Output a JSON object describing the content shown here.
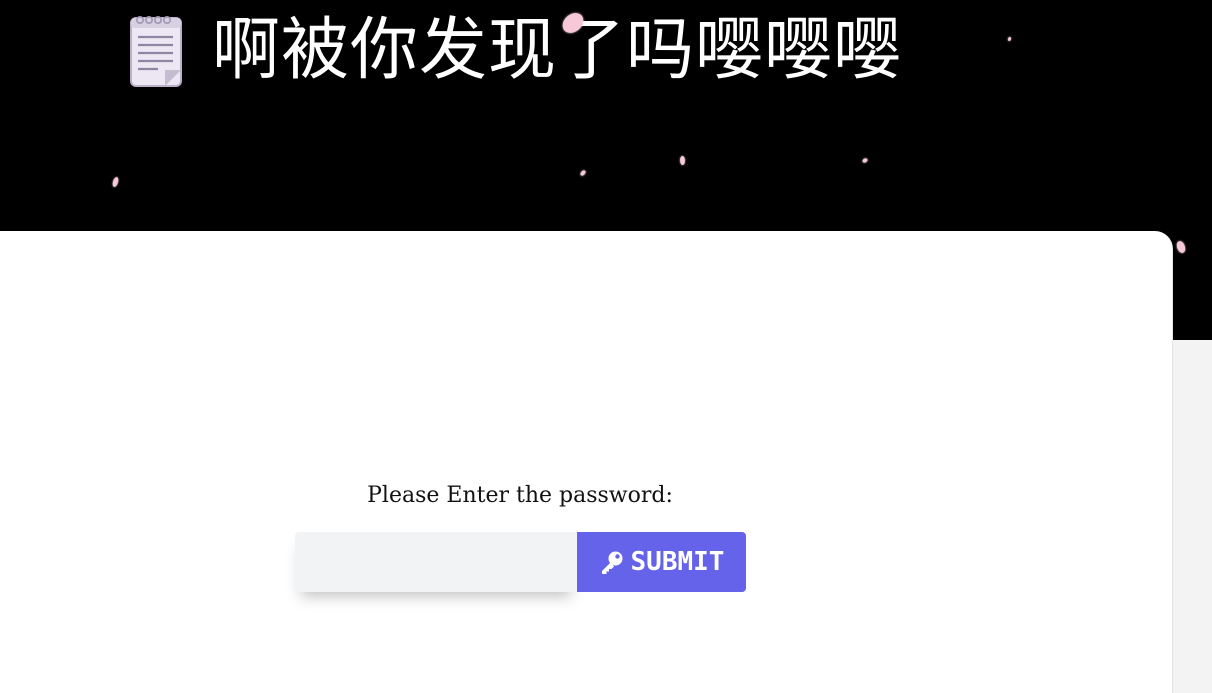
{
  "header": {
    "title": "啊被你发现了吗嘤嘤嘤",
    "title_icon": "notepad-icon",
    "decoration": "falling-cherry-blossom-petals",
    "background_color": "#000000",
    "petal_color": "#f7c9d8"
  },
  "login": {
    "prompt": "Please Enter the password:",
    "password_value": "",
    "password_placeholder": "",
    "submit_label": "SUBMIT",
    "submit_icon": "key-icon",
    "submit_color": "#6563e9"
  }
}
